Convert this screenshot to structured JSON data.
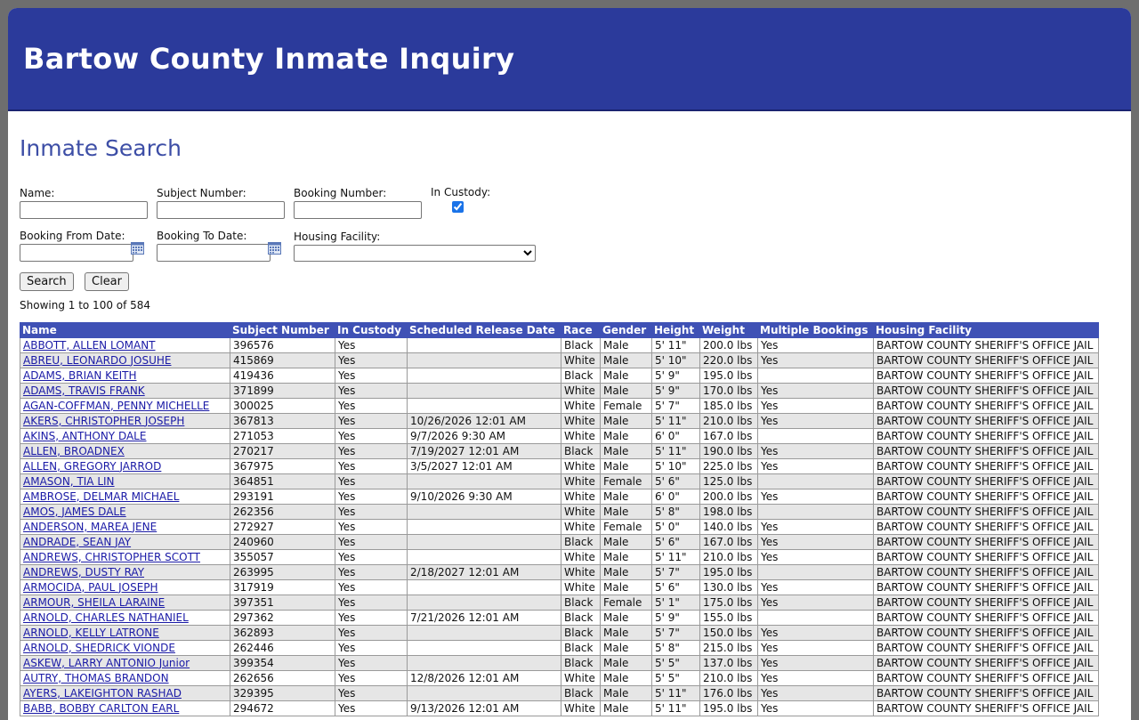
{
  "header": {
    "title": "Bartow County Inmate Inquiry"
  },
  "search": {
    "title": "Inmate Search",
    "name_label": "Name:",
    "name_value": "",
    "subject_label": "Subject Number:",
    "subject_value": "",
    "booking_label": "Booking Number:",
    "booking_value": "",
    "custody_label": "In Custody:",
    "custody_checked": true,
    "from_label": "Booking From Date:",
    "from_value": "",
    "to_label": "Booking To Date:",
    "to_value": "",
    "facility_label": "Housing Facility:",
    "facility_selected": "",
    "search_button": "Search",
    "clear_button": "Clear"
  },
  "results": {
    "showing": "Showing 1 to 100 of 584",
    "columns": [
      "Name",
      "Subject Number",
      "In Custody",
      "Scheduled Release Date",
      "Race",
      "Gender",
      "Height",
      "Weight",
      "Multiple Bookings",
      "Housing Facility"
    ],
    "rows": [
      [
        "ABBOTT, ALLEN LOMANT",
        "396576",
        "Yes",
        "",
        "Black",
        "Male",
        "5' 11\"",
        "200.0 lbs",
        "Yes",
        "BARTOW COUNTY SHERIFF'S OFFICE JAIL"
      ],
      [
        "ABREU, LEONARDO JOSUHE",
        "415869",
        "Yes",
        "",
        "White",
        "Male",
        "5' 10\"",
        "220.0 lbs",
        "Yes",
        "BARTOW COUNTY SHERIFF'S OFFICE JAIL"
      ],
      [
        "ADAMS, BRIAN KEITH",
        "419436",
        "Yes",
        "",
        "Black",
        "Male",
        "5' 9\"",
        "195.0 lbs",
        "",
        "BARTOW COUNTY SHERIFF'S OFFICE JAIL"
      ],
      [
        "ADAMS, TRAVIS FRANK",
        "371899",
        "Yes",
        "",
        "White",
        "Male",
        "5' 9\"",
        "170.0 lbs",
        "Yes",
        "BARTOW COUNTY SHERIFF'S OFFICE JAIL"
      ],
      [
        "AGAN-COFFMAN, PENNY MICHELLE",
        "300025",
        "Yes",
        "",
        "White",
        "Female",
        "5' 7\"",
        "185.0 lbs",
        "Yes",
        "BARTOW COUNTY SHERIFF'S OFFICE JAIL"
      ],
      [
        "AKERS, CHRISTOPHER JOSEPH",
        "367813",
        "Yes",
        "10/26/2026 12:01 AM",
        "White",
        "Male",
        "5' 11\"",
        "210.0 lbs",
        "Yes",
        "BARTOW COUNTY SHERIFF'S OFFICE JAIL"
      ],
      [
        "AKINS, ANTHONY DALE",
        "271053",
        "Yes",
        "9/7/2026 9:30 AM",
        "White",
        "Male",
        "6' 0\"",
        "167.0 lbs",
        "",
        "BARTOW COUNTY SHERIFF'S OFFICE JAIL"
      ],
      [
        "ALLEN, BROADNEX",
        "270217",
        "Yes",
        "7/19/2027 12:01 AM",
        "Black",
        "Male",
        "5' 11\"",
        "190.0 lbs",
        "Yes",
        "BARTOW COUNTY SHERIFF'S OFFICE JAIL"
      ],
      [
        "ALLEN, GREGORY JARROD",
        "367975",
        "Yes",
        "3/5/2027 12:01 AM",
        "White",
        "Male",
        "5' 10\"",
        "225.0 lbs",
        "Yes",
        "BARTOW COUNTY SHERIFF'S OFFICE JAIL"
      ],
      [
        "AMASON, TIA LIN",
        "364851",
        "Yes",
        "",
        "White",
        "Female",
        "5' 6\"",
        "125.0 lbs",
        "",
        "BARTOW COUNTY SHERIFF'S OFFICE JAIL"
      ],
      [
        "AMBROSE, DELMAR MICHAEL",
        "293191",
        "Yes",
        "9/10/2026 9:30 AM",
        "White",
        "Male",
        "6' 0\"",
        "200.0 lbs",
        "Yes",
        "BARTOW COUNTY SHERIFF'S OFFICE JAIL"
      ],
      [
        "AMOS, JAMES DALE",
        "262356",
        "Yes",
        "",
        "White",
        "Male",
        "5' 8\"",
        "198.0 lbs",
        "",
        "BARTOW COUNTY SHERIFF'S OFFICE JAIL"
      ],
      [
        "ANDERSON, MAREA JENE",
        "272927",
        "Yes",
        "",
        "White",
        "Female",
        "5' 0\"",
        "140.0 lbs",
        "Yes",
        "BARTOW COUNTY SHERIFF'S OFFICE JAIL"
      ],
      [
        "ANDRADE, SEAN JAY",
        "240960",
        "Yes",
        "",
        "Black",
        "Male",
        "5' 6\"",
        "167.0 lbs",
        "Yes",
        "BARTOW COUNTY SHERIFF'S OFFICE JAIL"
      ],
      [
        "ANDREWS, CHRISTOPHER SCOTT",
        "355057",
        "Yes",
        "",
        "White",
        "Male",
        "5' 11\"",
        "210.0 lbs",
        "Yes",
        "BARTOW COUNTY SHERIFF'S OFFICE JAIL"
      ],
      [
        "ANDREWS, DUSTY RAY",
        "263995",
        "Yes",
        "2/18/2027 12:01 AM",
        "White",
        "Male",
        "5' 7\"",
        "195.0 lbs",
        "",
        "BARTOW COUNTY SHERIFF'S OFFICE JAIL"
      ],
      [
        "ARMOCIDA, PAUL JOSEPH",
        "317919",
        "Yes",
        "",
        "White",
        "Male",
        "5' 6\"",
        "130.0 lbs",
        "Yes",
        "BARTOW COUNTY SHERIFF'S OFFICE JAIL"
      ],
      [
        "ARMOUR, SHEILA LARAINE",
        "397351",
        "Yes",
        "",
        "Black",
        "Female",
        "5' 1\"",
        "175.0 lbs",
        "Yes",
        "BARTOW COUNTY SHERIFF'S OFFICE JAIL"
      ],
      [
        "ARNOLD, CHARLES NATHANIEL",
        "297362",
        "Yes",
        "7/21/2026 12:01 AM",
        "Black",
        "Male",
        "5' 9\"",
        "155.0 lbs",
        "",
        "BARTOW COUNTY SHERIFF'S OFFICE JAIL"
      ],
      [
        "ARNOLD, KELLY LATRONE",
        "362893",
        "Yes",
        "",
        "Black",
        "Male",
        "5' 7\"",
        "150.0 lbs",
        "Yes",
        "BARTOW COUNTY SHERIFF'S OFFICE JAIL"
      ],
      [
        "ARNOLD, SHEDRICK VIONDE",
        "262446",
        "Yes",
        "",
        "Black",
        "Male",
        "5' 8\"",
        "215.0 lbs",
        "Yes",
        "BARTOW COUNTY SHERIFF'S OFFICE JAIL"
      ],
      [
        "ASKEW, LARRY ANTONIO Junior",
        "399354",
        "Yes",
        "",
        "Black",
        "Male",
        "5' 5\"",
        "137.0 lbs",
        "Yes",
        "BARTOW COUNTY SHERIFF'S OFFICE JAIL"
      ],
      [
        "AUTRY, THOMAS BRANDON",
        "262656",
        "Yes",
        "12/8/2026 12:01 AM",
        "White",
        "Male",
        "5' 5\"",
        "210.0 lbs",
        "Yes",
        "BARTOW COUNTY SHERIFF'S OFFICE JAIL"
      ],
      [
        "AYERS, LAKEIGHTON RASHAD",
        "329395",
        "Yes",
        "",
        "Black",
        "Male",
        "5' 11\"",
        "176.0 lbs",
        "Yes",
        "BARTOW COUNTY SHERIFF'S OFFICE JAIL"
      ],
      [
        "BABB, BOBBY CARLTON EARL",
        "294672",
        "Yes",
        "9/13/2026 12:01 AM",
        "White",
        "Male",
        "5' 11\"",
        "195.0 lbs",
        "Yes",
        "BARTOW COUNTY SHERIFF'S OFFICE JAIL"
      ]
    ]
  }
}
